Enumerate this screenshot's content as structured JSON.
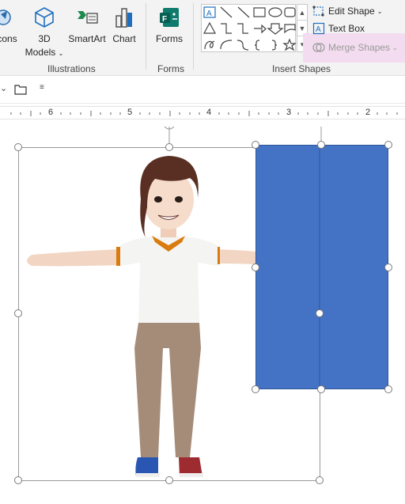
{
  "ribbon": {
    "icons_label": "cons",
    "models_label_1": "3D",
    "models_label_2": "Models",
    "smartart_label": "SmartArt",
    "chart_label": "Chart",
    "forms_label": "Forms",
    "group_illustrations": "Illustrations",
    "group_forms": "Forms",
    "group_insert_shapes": "Insert Shapes",
    "edit_shape": "Edit Shape",
    "text_box": "Text Box",
    "merge_shapes": "Merge Shapes"
  },
  "ruler": {
    "ticks": [
      "6",
      "5",
      "4",
      "3",
      "2"
    ]
  },
  "colors": {
    "accent": "#4472c4",
    "merge_highlight": "#f3dcef",
    "ribbon_bg": "#f3f3f3"
  },
  "icons": [
    "icons-icon",
    "cube-3d-icon",
    "smartart-icon",
    "chart-icon",
    "forms-icon",
    "edit-shape-icon",
    "text-box-icon",
    "merge-shapes-icon",
    "folder-icon"
  ]
}
